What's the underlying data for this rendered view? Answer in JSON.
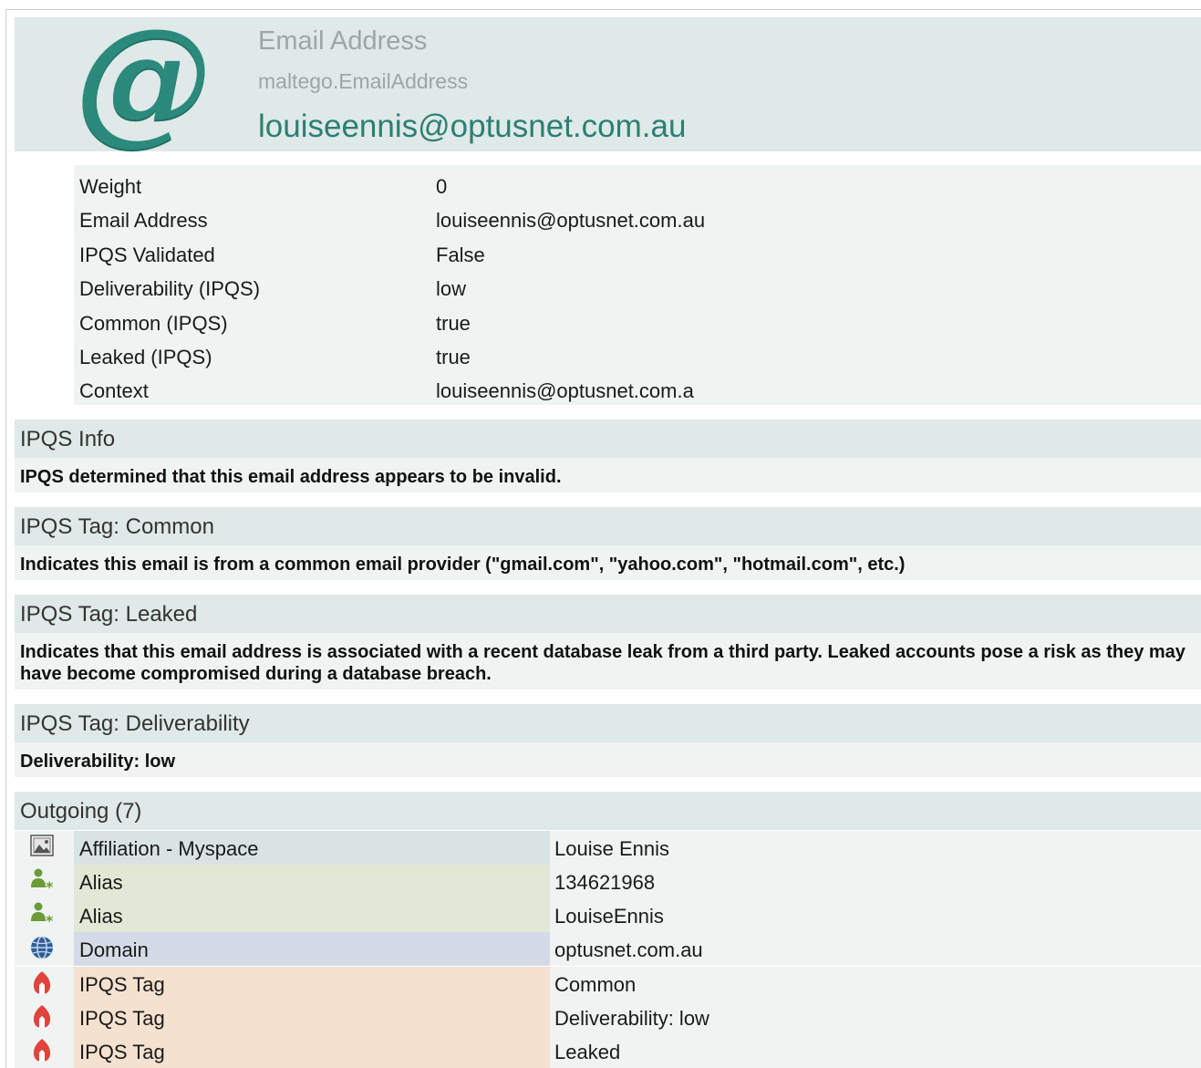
{
  "entity": {
    "type_label": "Email Address",
    "type_id": "maltego.EmailAddress",
    "value": "louiseennis@optusnet.com.au"
  },
  "properties": [
    {
      "name": "Weight",
      "value": "0"
    },
    {
      "name": "Email Address",
      "value": "louiseennis@optusnet.com.au"
    },
    {
      "name": "IPQS Validated",
      "value": "False"
    },
    {
      "name": "Deliverability (IPQS)",
      "value": "low"
    },
    {
      "name": "Common (IPQS)",
      "value": "true"
    },
    {
      "name": "Leaked (IPQS)",
      "value": "true"
    },
    {
      "name": "Context",
      "value": "louiseennis@optusnet.com.a"
    }
  ],
  "sections": [
    {
      "title": "IPQS Info",
      "body": "IPQS determined that this email address appears to be invalid."
    },
    {
      "title": "IPQS Tag: Common",
      "body": "Indicates this email is from a common email provider (\"gmail.com\", \"yahoo.com\", \"hotmail.com\", etc.)"
    },
    {
      "title": "IPQS Tag: Leaked",
      "body": "Indicates that this email address is associated with a recent database leak from a third party. Leaked accounts pose a risk as they may have become compromised during a database breach."
    },
    {
      "title": "IPQS Tag: Deliverability",
      "body": "Deliverability: low"
    }
  ],
  "outgoing": {
    "title": "Outgoing (7)",
    "items": [
      {
        "icon": "image-icon",
        "type": "Affiliation - Myspace",
        "value": "Louise Ennis",
        "color": "#d9e3e3"
      },
      {
        "icon": "person-alias-icon",
        "type": "Alias",
        "value": "134621968",
        "color": "#e2e8d5"
      },
      {
        "icon": "person-alias-icon",
        "type": "Alias",
        "value": "LouiseEnnis",
        "color": "#e2e8d5"
      },
      {
        "icon": "globe-icon",
        "type": "Domain",
        "value": "optusnet.com.au",
        "color": "#d5dbe6"
      },
      {
        "icon": "flame-tag-icon",
        "type": "IPQS Tag",
        "value": "Common",
        "color": "#f4e1cf"
      },
      {
        "icon": "flame-tag-icon",
        "type": "IPQS Tag",
        "value": "Deliverability: low",
        "color": "#f4e1cf"
      },
      {
        "icon": "flame-tag-icon",
        "type": "IPQS Tag",
        "value": "Leaked",
        "color": "#f4e1cf"
      }
    ]
  }
}
